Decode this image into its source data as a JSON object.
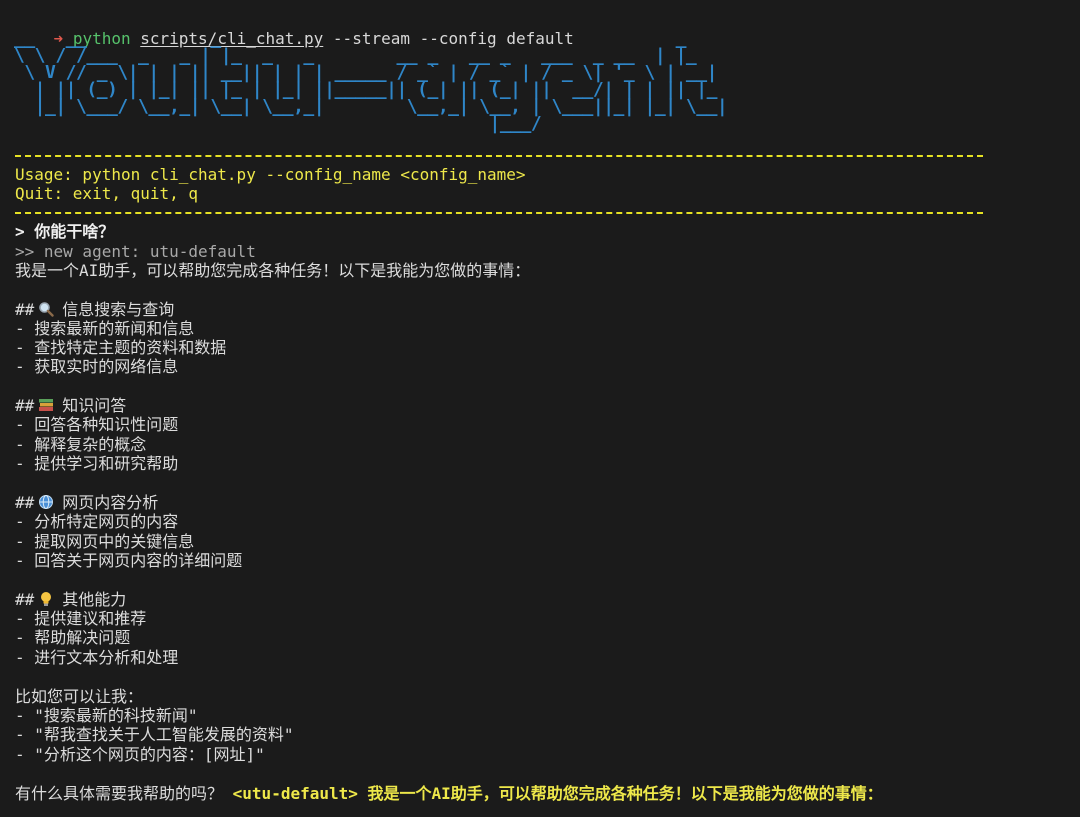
{
  "command": {
    "arrow": "➜",
    "program": "python",
    "script": "scripts/cli_chat.py",
    "args": "--stream --config default"
  },
  "banner_text": "Youtu-agent",
  "usage": "Usage: python cli_chat.py --config_name <config_name>",
  "quit": "Quit: exit, quit, q",
  "user_prompt": "> 你能干啥？",
  "new_agent": ">> new agent: utu-default",
  "intro": "我是一个AI助手，可以帮助您完成各种任务！以下是我能为您做的事情：",
  "sections": [
    {
      "heading_prefix": "##",
      "icon": "magnifier-icon",
      "title": "信息搜索与查询",
      "items": [
        "- 搜索最新的新闻和信息",
        "- 查找特定主题的资料和数据",
        "- 获取实时的网络信息"
      ]
    },
    {
      "heading_prefix": "##",
      "icon": "books-icon",
      "title": "知识问答",
      "items": [
        "- 回答各种知识性问题",
        "- 解释复杂的概念",
        "- 提供学习和研究帮助"
      ]
    },
    {
      "heading_prefix": "##",
      "icon": "globe-icon",
      "title": "网页内容分析",
      "items": [
        "- 分析特定网页的内容",
        "- 提取网页中的关键信息",
        "- 回答关于网页内容的详细问题"
      ]
    },
    {
      "heading_prefix": "##",
      "icon": "lightbulb-icon",
      "title": "其他能力",
      "items": [
        "- 提供建议和推荐",
        "- 帮助解决问题",
        "- 进行文本分析和处理"
      ]
    }
  ],
  "examples_intro": "比如您可以让我：",
  "examples": [
    "- \"搜索最新的科技新闻\"",
    "- \"帮我查找关于人工智能发展的资料\"",
    "- \"分析这个网页的内容：[网址]\""
  ],
  "closing": "有什么具体需要我帮助的吗？",
  "final_tag": "<utu-default>",
  "final_text": "我是一个AI助手，可以帮助您完成各种任务！以下是我能为您做的事情：",
  "colors": {
    "background": "#1b1b1b",
    "banner": "#2f86c8",
    "yellow": "#eee84a",
    "green": "#56c26b",
    "arrow": "#e0584d"
  }
}
